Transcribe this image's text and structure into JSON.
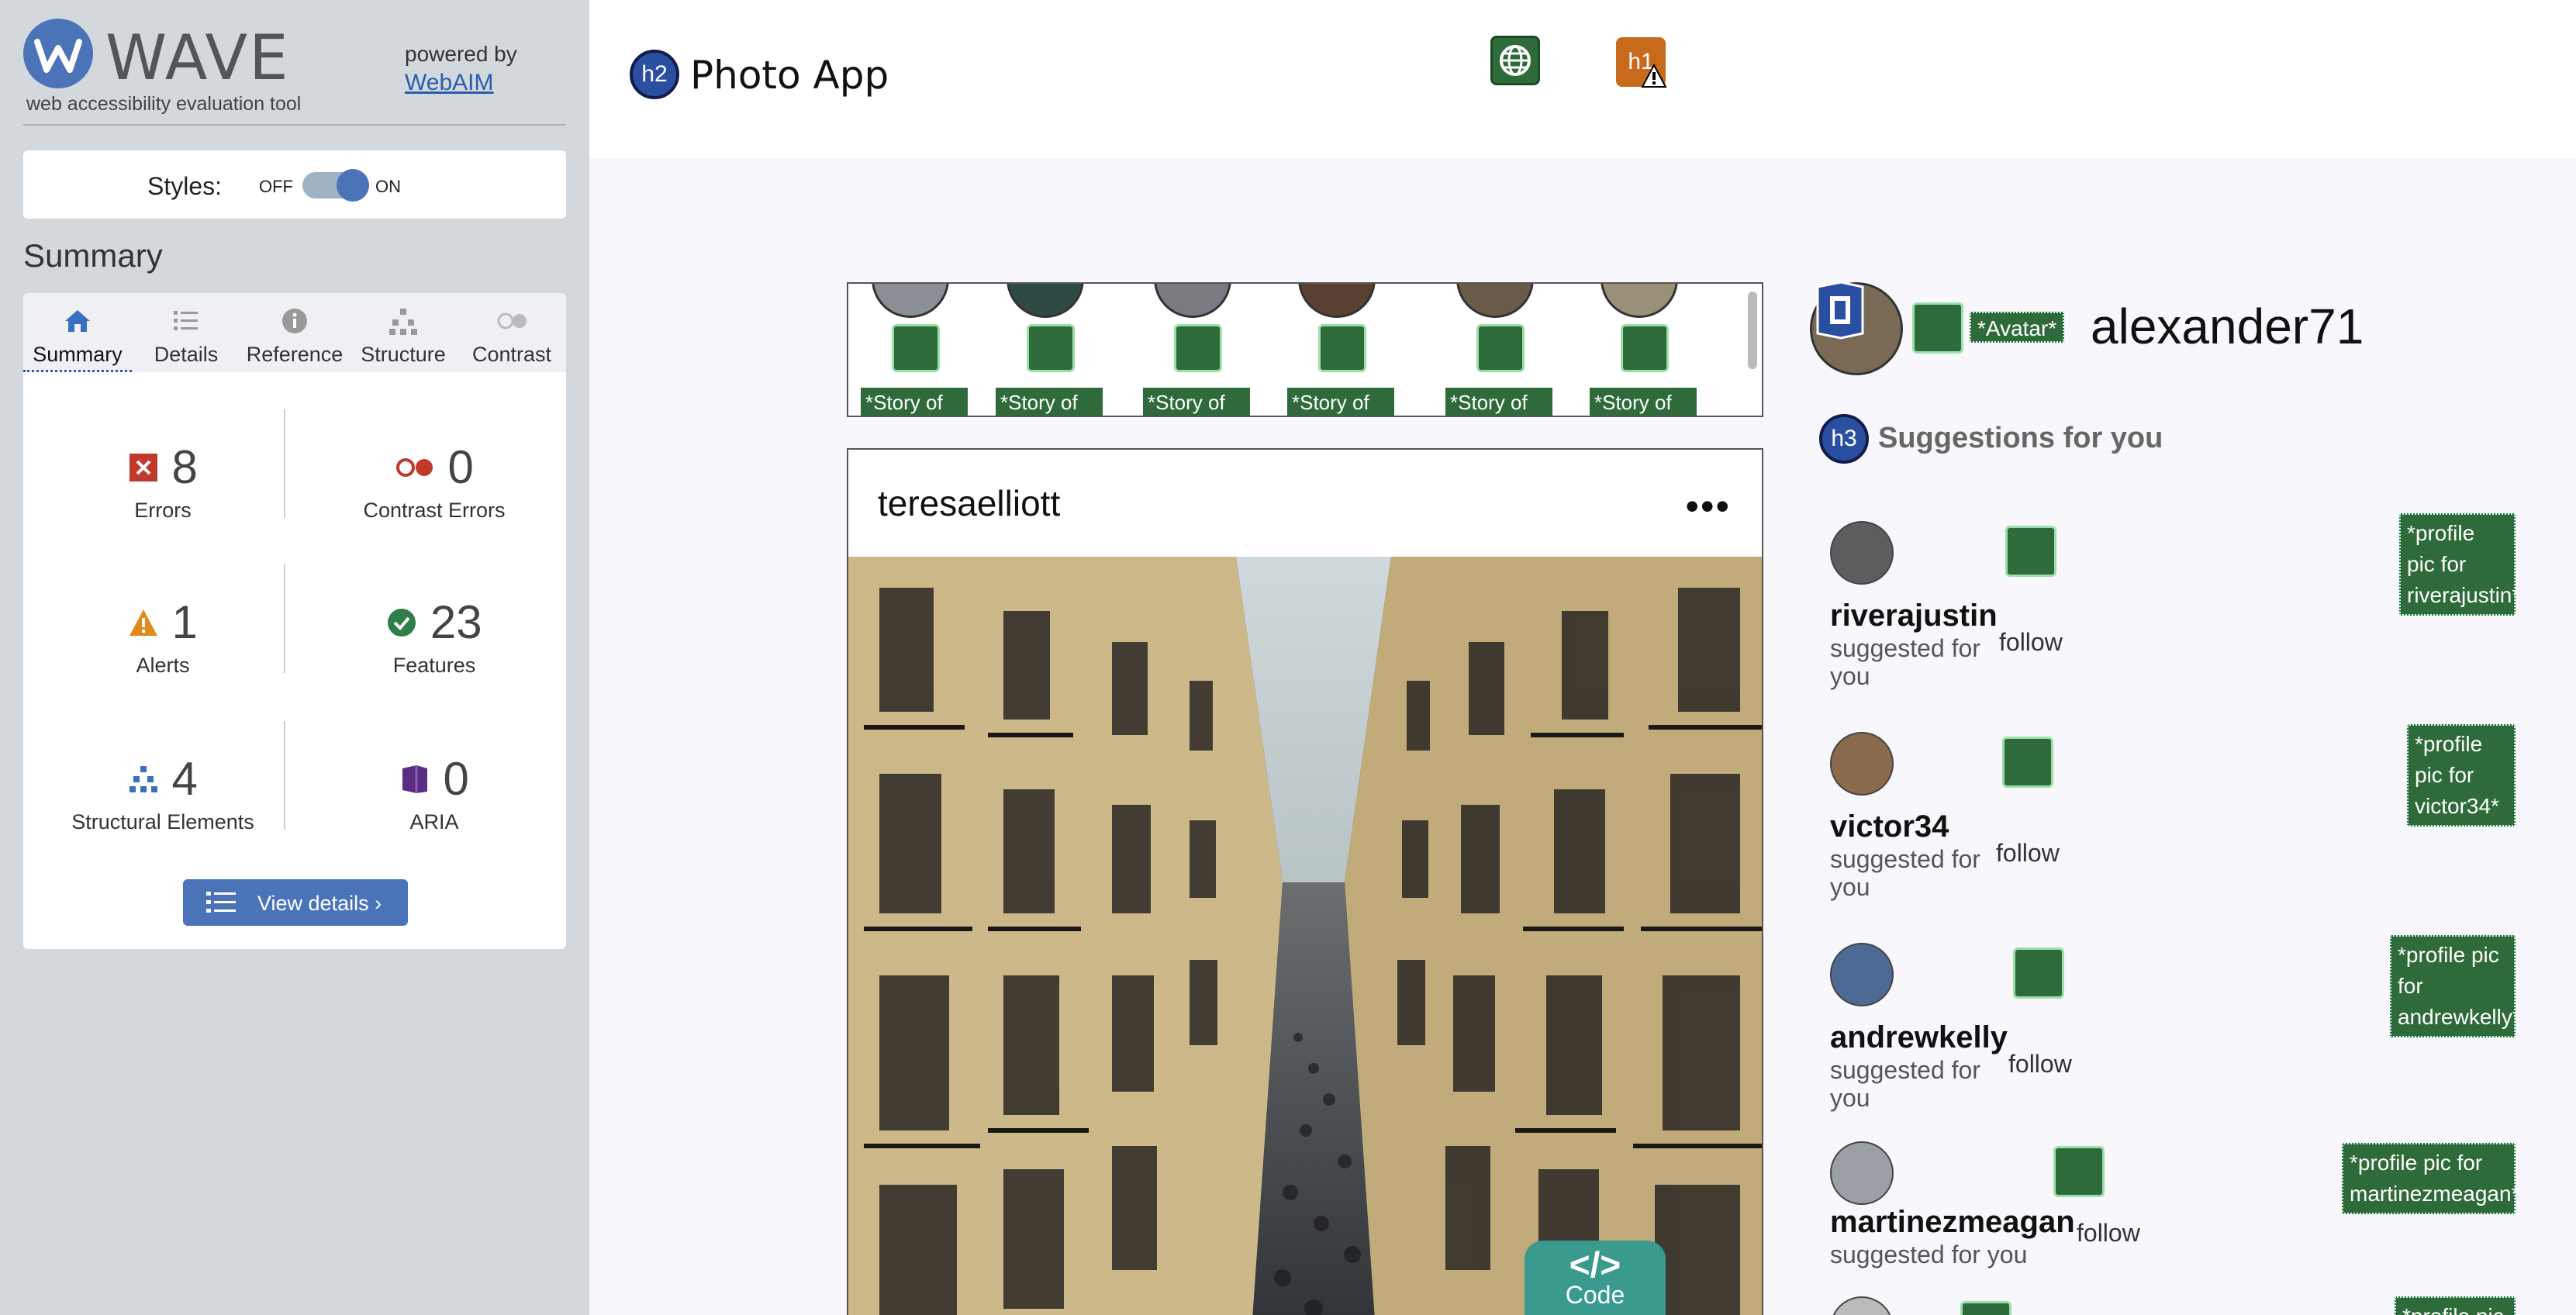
{
  "wave": {
    "title": "WAVE",
    "tagline": "web accessibility evaluation tool",
    "powered_by": "powered by",
    "webaim_link": "WebAIM",
    "styles_label": "Styles:",
    "styles_off": "OFF",
    "styles_on": "ON",
    "summary_heading": "Summary",
    "tabs": [
      {
        "label": "Summary",
        "icon": "home-icon"
      },
      {
        "label": "Details",
        "icon": "list-icon"
      },
      {
        "label": "Reference",
        "icon": "info-icon"
      },
      {
        "label": "Structure",
        "icon": "structure-icon"
      },
      {
        "label": "Contrast",
        "icon": "contrast-icon"
      }
    ],
    "stats": {
      "errors": {
        "count": "8",
        "label": "Errors",
        "color": "#c0392b"
      },
      "contrast_errors": {
        "count": "0",
        "label": "Contrast Errors",
        "color": "#c0392b"
      },
      "alerts": {
        "count": "1",
        "label": "Alerts",
        "color": "#e08a1e"
      },
      "features": {
        "count": "23",
        "label": "Features",
        "color": "#2f7d4a"
      },
      "structural": {
        "count": "4",
        "label": "Structural Elements",
        "color": "#3a6fbf"
      },
      "aria": {
        "count": "0",
        "label": "ARIA",
        "color": "#5a2d82"
      }
    },
    "view_details": "View details ›"
  },
  "app": {
    "title": "Photo App",
    "title_badge": "h2",
    "h1_badge": "h1",
    "stories": [
      "*Story of",
      "*Story of",
      "*Story of",
      "*Story of",
      "*Story of",
      "*Story of"
    ],
    "post": {
      "username": "teresaelliott",
      "more": "•••"
    },
    "code_tab": {
      "glyph": "</>",
      "label": "Code"
    },
    "profile": {
      "avatar_tag": "*Avatar*",
      "username": "alexander71"
    },
    "suggestions_badge": "h3",
    "suggestions_title": "Suggestions for you",
    "suggestions": [
      {
        "name": "riverajustin",
        "sub": "suggested for you",
        "follow": "follow",
        "tag": "*profile pic for riverajustin*"
      },
      {
        "name": "victor34",
        "sub": "suggested for you",
        "follow": "follow",
        "tag": "*profile pic for victor34*"
      },
      {
        "name": "andrewkelly",
        "sub": "suggested for you",
        "follow": "follow",
        "tag": "*profile pic for andrewkelly*"
      },
      {
        "name": "martinezmeagan",
        "sub": "suggested for you",
        "follow": "follow",
        "tag": "*profile pic for martinezmeagan*"
      },
      {
        "tag": "*profile pic"
      }
    ],
    "accent_green": "#2f6b3a"
  }
}
